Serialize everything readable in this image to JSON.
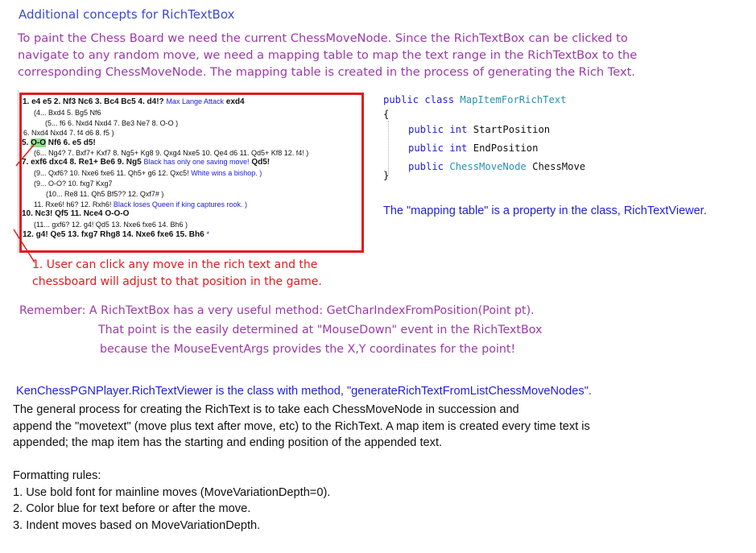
{
  "heading": "Additional concepts for RichTextBox",
  "intro": [
    "To paint the Chess Board we need the current ChessMoveNode. Since the RichTextBox can be clicked to",
    "navigate to any random move, we need a mapping table to map the text range in the RichTextBox to the",
    "corresponding ChessMoveNode.  The mapping table is created in the process of generating the Rich Text."
  ],
  "rtb": {
    "lines": [
      {
        "pre": "1. e4 e5 2. Nf3 Nc6 3. Bc4 Bc5 4. d4!? ",
        "comment": "Max Lange Attack",
        "post": " exd4"
      },
      {
        "pre": "(4... Bxd4 5. Bg5 Nf6"
      },
      {
        "pre": "(5... f6 6. Nxd4 Nxd4 7. Be3 Ne7 8. O-O )"
      },
      {
        "pre": "6. Nxd4 Nxd4 7. f4 d6 8. f5 )"
      },
      {
        "pre": "5. ",
        "hl": "O-O",
        "post": " Nf6 6. e5 d5!"
      },
      {
        "pre": "(6... Ng4? 7. Bxf7+ Kxf7 8. Ng5+ Kg8 9. Qxg4 Nxe5 10. Qe4 d6 11. Qd5+ Kf8 12. f4! )"
      },
      {
        "pre": "7. exf6 dxc4 8. Re1+ Be6 9. Ng5 ",
        "comment": "Black has only  one saving move!",
        "post": " Qd5!"
      },
      {
        "pre": "(9... Qxf6? 10. Nxe6 fxe6 11. Qh5+ g6 12. Qxc5! ",
        "comment": "White wins a bishop.  )"
      },
      {
        "pre": "(9... O-O? 10. fxg7 Kxg7"
      },
      {
        "pre": "(10... Re8 11. Qh5 Bf5?? 12. Qxf7# )"
      },
      {
        "pre": "11. Rxe6! h6? 12. Rxh6! ",
        "comment": "Black loses Queen if king captures  rook.  )"
      },
      {
        "pre": "10. Nc3! Qf5 11. Nce4 O-O-O"
      },
      {
        "pre": "(11... gxf6? 12. g4! Qd5 13. Nxe6 fxe6 14. Bh6 )"
      },
      {
        "pre": "12. g4! Qe5 13. fxg7 Rhg8 14. Nxe6 fxe6 15. Bh6  ",
        "comment": "*"
      }
    ]
  },
  "click_note": [
    "1. User can click any move in the rich text and the",
    "chessboard will adjust to that position in the game."
  ],
  "code": {
    "line1_kw1": "public",
    "line1_kw2": "class",
    "line1_type": "MapItemForRichText",
    "open_brace": "{",
    "close_brace": "}",
    "prop1_kw": "public",
    "prop1_type": "int",
    "prop1_name": "StartPosition",
    "prop2_kw": "public",
    "prop2_type": "int",
    "prop2_name": "EndPosition",
    "prop3_kw": "public",
    "prop3_type": "ChessMoveNode",
    "prop3_name": "ChessMove"
  },
  "map_note": "The \"mapping table\" is a property in the class, RichTextViewer.",
  "remember": [
    "Remember:  A RichTextBox has a very useful method: GetCharIndexFromPosition(Point pt).",
    "That point is the easily determined at \"MouseDown\" event in the RichTextBox",
    "because the MouseEventArgs provides the X,Y coordinates for the point!"
  ],
  "class_line": "KenChessPGNPlayer.RichTextViewer is the class with method, \"generateRichTextFromListChessMoveNodes\".",
  "general": [
    "The general process for creating the RichText is to take each ChessMoveNode in succession and",
    "append the \"movetext\" (move plus text after move, etc) to the RichText.  A map item is created every time text is",
    "appended; the map item has the starting and ending position of the appended text."
  ],
  "rules": [
    "Formatting rules:",
    "1. Use bold font for mainline moves (MoveVariationDepth=0).",
    "2. Color blue for text before or after the move.",
    "3. Indent moves based on MoveVariationDepth."
  ],
  "colors": {
    "annotation_red": "#e01b1b",
    "purple_text": "#9a3aa6",
    "blue_text": "#1f1fd6",
    "highlight_green": "#8fe08f"
  }
}
